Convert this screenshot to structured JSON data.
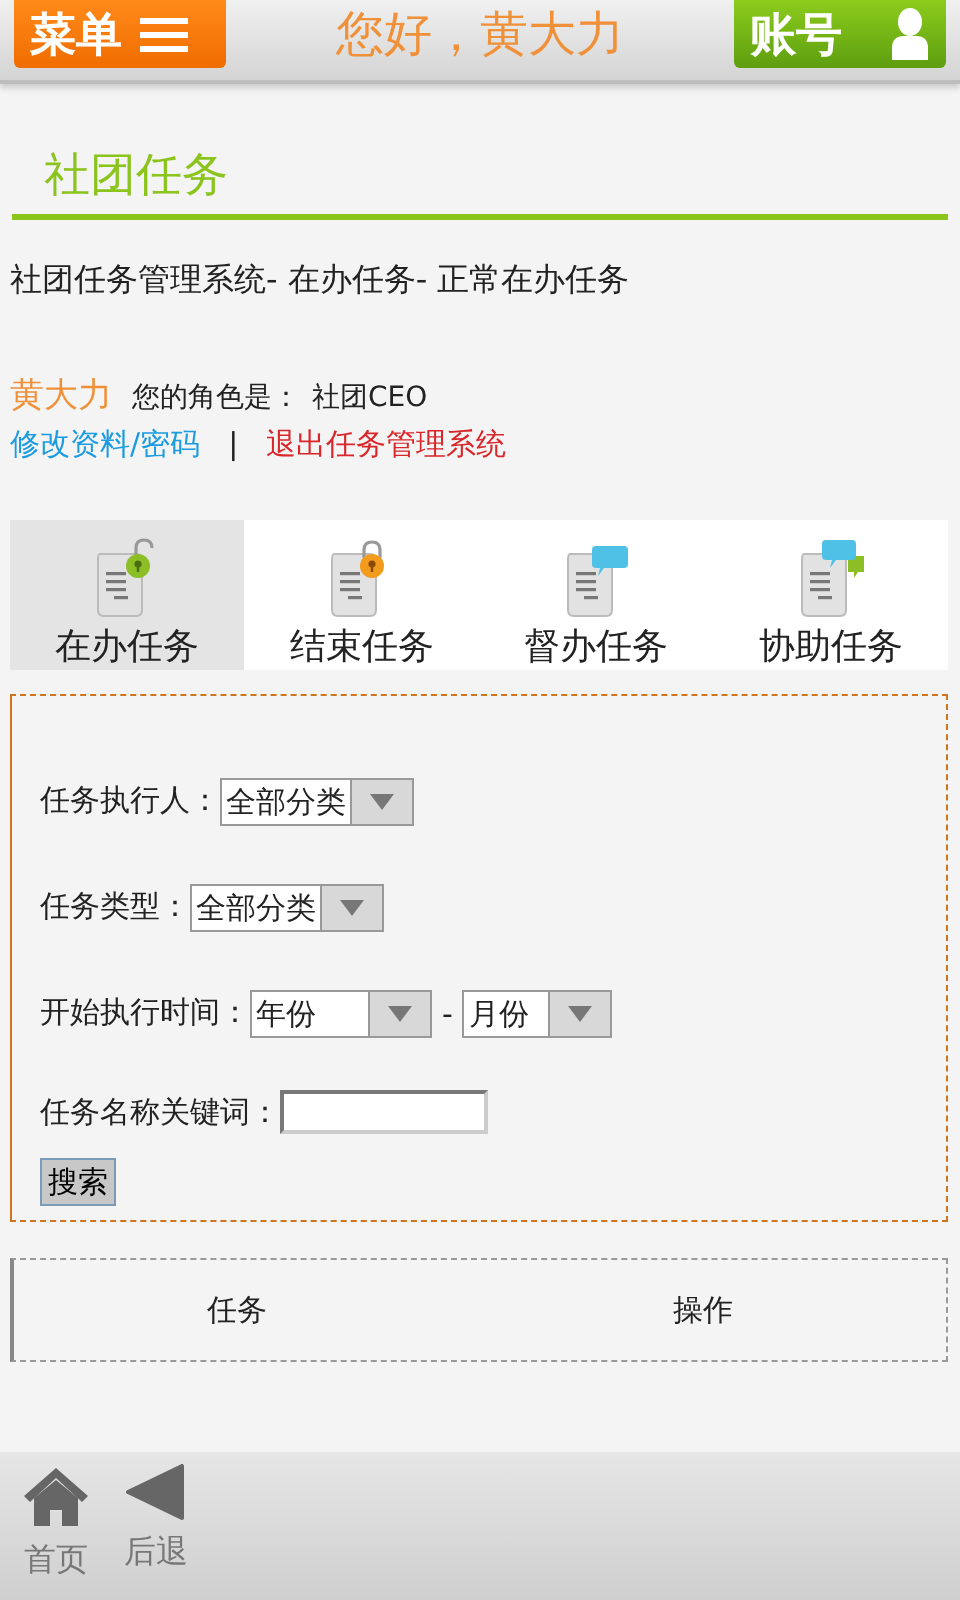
{
  "header": {
    "menu_button": "菜单",
    "greeting": "您好，黄大力",
    "account_button": "账号"
  },
  "section_title": "社团任务",
  "breadcrumb": "社团任务管理系统- 在办任务- 正常在办任务",
  "user": {
    "name": "黄大力",
    "role_label": "您的角色是：",
    "role_value": "社团CEO"
  },
  "links": [
    {
      "kind": "edit",
      "text": "修改资料/密码"
    },
    {
      "kind": "separator",
      "text": "|"
    },
    {
      "kind": "logout",
      "text": "退出任务管理系统"
    }
  ],
  "tabs": [
    {
      "kind": "unlocked",
      "label": "在办任务",
      "selected": true
    },
    {
      "kind": "locked",
      "label": "结束任务",
      "selected": false
    },
    {
      "kind": "bubble",
      "label": "督办任务",
      "selected": false
    },
    {
      "kind": "bubbles",
      "label": "协助任务",
      "selected": false
    }
  ],
  "filters": [
    {
      "kind": "select",
      "label": "任务执行人：",
      "value": "全部分类"
    },
    {
      "kind": "select",
      "label": "任务类型：",
      "value": "全部分类"
    },
    {
      "kind": "range",
      "label": "开始执行时间：",
      "from": "年份",
      "separator": "-",
      "to": "月份"
    },
    {
      "kind": "text",
      "label": "任务名称关键词："
    }
  ],
  "search_button": "搜索",
  "table": {
    "columns": [
      "任务",
      "操作"
    ]
  },
  "bottom_nav": [
    {
      "kind": "home",
      "label": "首页"
    },
    {
      "kind": "back",
      "label": "后退"
    }
  ]
}
